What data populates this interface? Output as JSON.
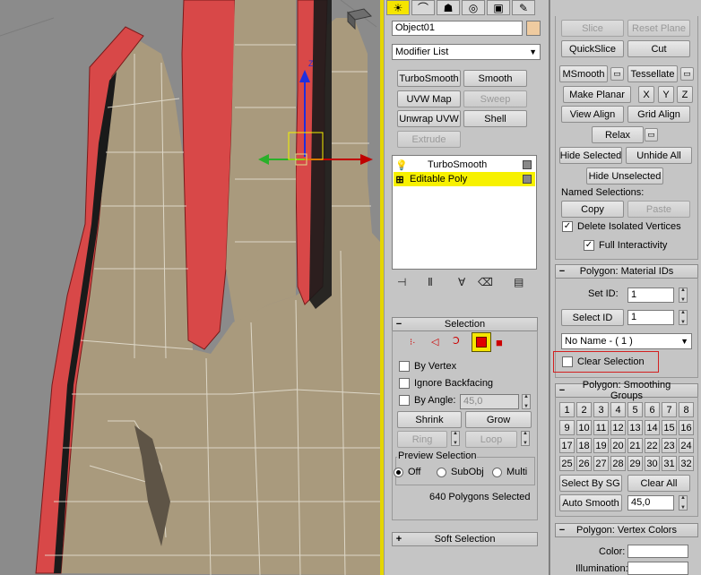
{
  "cmd_tabs": [
    {
      "icon": "sun-icon",
      "glyph": "☀"
    },
    {
      "icon": "modify-icon",
      "glyph": "⌒"
    },
    {
      "icon": "hierarchy-icon",
      "glyph": "☗"
    },
    {
      "icon": "motion-icon",
      "glyph": "◎"
    },
    {
      "icon": "display-icon",
      "glyph": "▣"
    },
    {
      "icon": "utilities-icon",
      "glyph": "✎"
    }
  ],
  "object_name": "Object01",
  "object_color": "#efcba0",
  "modifier_list": "Modifier List",
  "modifier_buttons": [
    "TurboSmooth",
    "Smooth",
    "UVW Map",
    "Sweep",
    "Unwrap UVW",
    "Shell",
    "Extrude"
  ],
  "stack_items": [
    "TurboSmooth",
    "Editable Poly"
  ],
  "selection": {
    "title": "Selection",
    "by_vertex": "By Vertex",
    "ignore_backfacing": "Ignore Backfacing",
    "by_angle": "By Angle:",
    "angle_value": "45,0",
    "shrink": "Shrink",
    "grow": "Grow",
    "ring": "Ring",
    "loop": "Loop",
    "preview_title": "Preview Selection",
    "preview_off": "Off",
    "preview_subobj": "SubObj",
    "preview_multi": "Multi",
    "status": "640 Polygons Selected"
  },
  "soft_selection": "Soft Selection",
  "edit_geometry": {
    "slice": "Slice",
    "reset_plane": "Reset Plane",
    "quickslice": "QuickSlice",
    "cut": "Cut",
    "msmooth": "MSmooth",
    "tessellate": "Tessellate",
    "make_planar": "Make Planar",
    "x": "X",
    "y": "Y",
    "z": "Z",
    "view_align": "View Align",
    "grid_align": "Grid Align",
    "relax": "Relax",
    "hide_selected": "Hide Selected",
    "unhide_all": "Unhide All",
    "hide_unselected": "Hide Unselected",
    "named_selections": "Named Selections:",
    "copy": "Copy",
    "paste": "Paste",
    "delete_isolated": "Delete Isolated Vertices",
    "full_interactivity": "Full Interactivity"
  },
  "material_ids": {
    "title": "Polygon: Material IDs",
    "set_id_label": "Set ID:",
    "set_id_value": "1",
    "select_id": "Select ID",
    "select_id_value": "1",
    "material_name": "No Name - ( 1 )",
    "clear_selection": "Clear Selection"
  },
  "smoothing_groups": {
    "title": "Polygon: Smoothing Groups",
    "numbers": [
      "1",
      "2",
      "3",
      "4",
      "5",
      "6",
      "7",
      "8",
      "9",
      "10",
      "11",
      "12",
      "13",
      "14",
      "15",
      "16",
      "17",
      "18",
      "19",
      "20",
      "21",
      "22",
      "23",
      "24",
      "25",
      "26",
      "27",
      "28",
      "29",
      "30",
      "31",
      "32"
    ],
    "select_by_sg": "Select By SG",
    "clear_all": "Clear All",
    "auto_smooth": "Auto Smooth",
    "auto_smooth_value": "45,0"
  },
  "vertex_colors": {
    "title": "Polygon: Vertex Colors",
    "color_label": "Color:",
    "illumination_label": "Illumination:"
  },
  "colors": {
    "accent_yellow": "#f5e500",
    "selected_poly": "#d84848",
    "mesh_skin": "#a99a7d"
  },
  "viewport": {
    "axis_z": "Z"
  }
}
